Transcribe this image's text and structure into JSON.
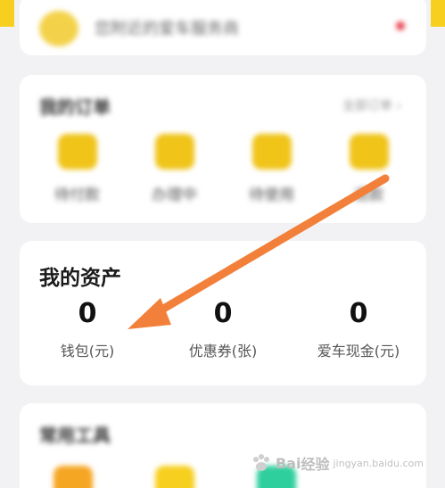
{
  "top": {
    "shop_name": "您附近的爱车服务商"
  },
  "orders": {
    "title": "我的订单",
    "view_all": "全部订单 ›",
    "items": [
      {
        "label": "待付款",
        "icon": "wallet-icon"
      },
      {
        "label": "办理中",
        "icon": "clipboard-icon"
      },
      {
        "label": "待使用",
        "icon": "ticket-icon"
      },
      {
        "label": "退款",
        "icon": "refund-icon"
      }
    ]
  },
  "assets": {
    "title": "我的资产",
    "items": [
      {
        "value": "0",
        "label": "钱包(元)"
      },
      {
        "value": "0",
        "label": "优惠券(张)"
      },
      {
        "value": "0",
        "label": "爱车现金(元)"
      }
    ]
  },
  "tools": {
    "title": "常用工具",
    "icon_colors": [
      "#f5a623",
      "#f7cf1f",
      "#2fcf9d"
    ]
  },
  "colors": {
    "accent_yellow": "#f7cf1f",
    "arrow": "#f2803a"
  },
  "watermark": {
    "text": "Bai",
    "text2": "经验",
    "sub": "jingyan.baidu.com"
  }
}
